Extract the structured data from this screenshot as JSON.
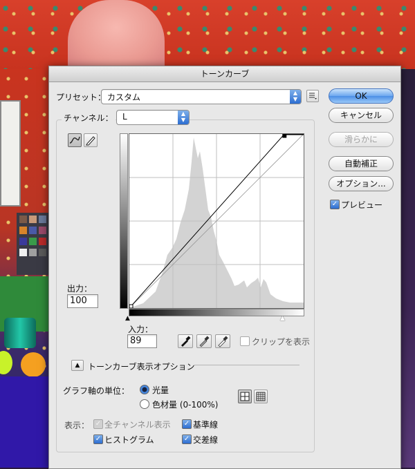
{
  "dialog": {
    "title": "トーンカーブ",
    "preset_label": "プリセット：",
    "preset_value": "カスタム",
    "channel_label": "チャンネル：",
    "channel_value": "L",
    "output_label": "出力：",
    "output_value": "100",
    "input_label": "入力：",
    "input_value": "89",
    "clip_label": "クリップを表示",
    "clip_checked": false,
    "options_section_label": "トーンカーブ表示オプション",
    "graph_unit_label": "グラフ軸の単位：",
    "unit_options": [
      "光量",
      "色材量 (0-100%)"
    ],
    "unit_selected": "光量",
    "display_label": "表示：",
    "display_options": [
      {
        "label": "全チャンネル表示",
        "checked": true,
        "enabled": false
      },
      {
        "label": "基準線",
        "checked": true,
        "enabled": true
      },
      {
        "label": "ヒストグラム",
        "checked": true,
        "enabled": true
      },
      {
        "label": "交差線",
        "checked": true,
        "enabled": true
      }
    ]
  },
  "buttons": {
    "ok": "OK",
    "cancel": "キャンセル",
    "smooth": "滑らかに",
    "auto": "自動補正",
    "options": "オプション..."
  },
  "preview": {
    "label": "プレビュー",
    "checked": true
  },
  "curve": {
    "points": [
      {
        "input": 0,
        "output": 0
      },
      {
        "input": 89,
        "output": 100
      }
    ]
  },
  "colors": {
    "accent": "#2c6dd1",
    "histogram": "#d3d3d3"
  }
}
